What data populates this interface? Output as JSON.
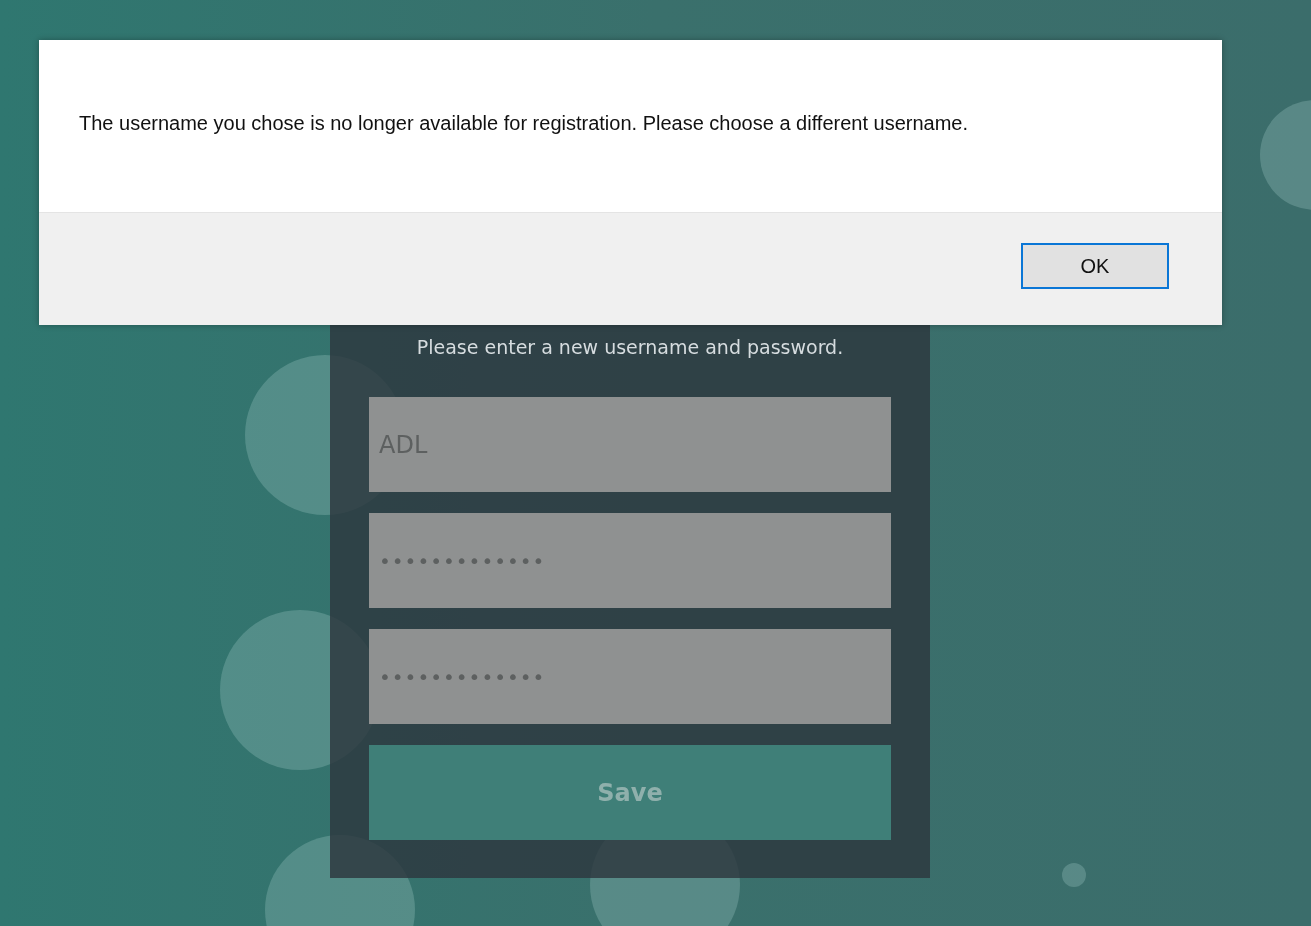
{
  "form": {
    "instruction": "Please enter a new username and password.",
    "fields": [
      {
        "kind": "text",
        "value": "ADL"
      },
      {
        "kind": "password",
        "value": "•••••••••••••"
      },
      {
        "kind": "password",
        "value": "•••••••••••••"
      }
    ],
    "save_button": "Save"
  },
  "dialog": {
    "message": "The username you chose is no longer available for registration. Please choose a different username.",
    "button": "OK"
  }
}
